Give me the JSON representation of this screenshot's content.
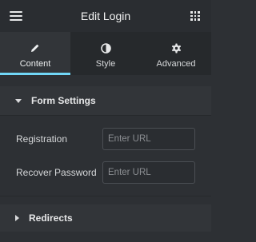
{
  "header": {
    "title": "Edit Login",
    "menu_icon": "hamburger-icon",
    "apps_icon": "grid-icon"
  },
  "tabs": [
    {
      "label": "Content",
      "icon": "pencil-icon",
      "active": true
    },
    {
      "label": "Style",
      "icon": "half-circle-icon",
      "active": false
    },
    {
      "label": "Advanced",
      "icon": "gear-icon",
      "active": false
    }
  ],
  "sections": {
    "form_settings": {
      "title": "Form Settings",
      "expanded": true,
      "fields": [
        {
          "label": "Registration",
          "value": "",
          "placeholder": "Enter URL"
        },
        {
          "label": "Recover Password",
          "value": "",
          "placeholder": "Enter URL"
        }
      ]
    },
    "redirects": {
      "title": "Redirects",
      "expanded": false
    }
  },
  "colors": {
    "accent": "#71d7f7",
    "panel_bg": "#2d3034",
    "header_bg": "#2a2d31"
  }
}
